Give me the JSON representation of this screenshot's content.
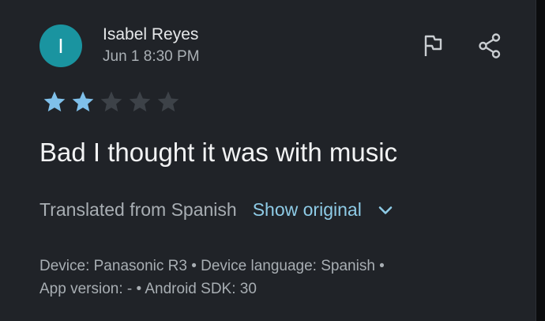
{
  "review": {
    "avatar_letter": "I",
    "author": "Isabel Reyes",
    "date": "Jun 1 8:30 PM",
    "rating": 2,
    "max_rating": 5,
    "text": "Bad I thought it was with music"
  },
  "translation": {
    "label": "Translated from Spanish",
    "show_original": "Show original"
  },
  "device_info": {
    "line1": "Device: Panasonic R3 • Device language: Spanish •",
    "line2": "App version: - • Android SDK: 30"
  },
  "icons": {
    "flag": "flag-icon",
    "share": "share-icon",
    "chevron": "chevron-down-icon",
    "star": "star-icon"
  },
  "colors": {
    "background": "#202328",
    "avatar": "#1a94a0",
    "star_filled": "#7fc0ea",
    "star_empty": "#3d4248",
    "link": "#8ecbe6"
  }
}
